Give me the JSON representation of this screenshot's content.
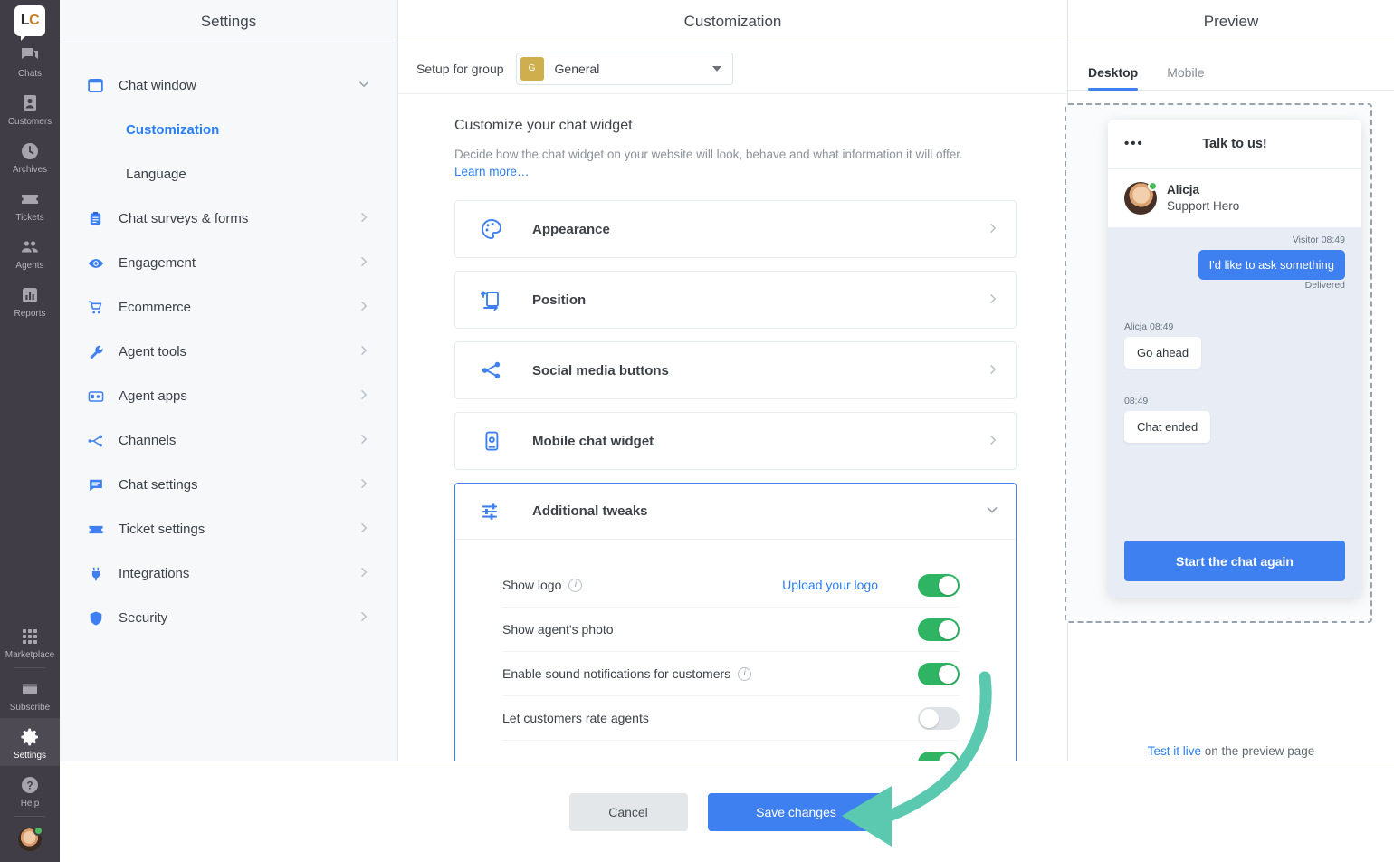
{
  "colors": {
    "accent_blue": "#3f80f0",
    "link_blue": "#2b7ef5",
    "toggle_green": "#2fb463",
    "rail_dark": "#413d46",
    "group_badge_gold": "#cfae4d",
    "annotation_teal": "#5ac9b0"
  },
  "rail": {
    "logo_left": "L",
    "logo_right": "C",
    "items": [
      {
        "label": "Chats",
        "icon": "chats-icon"
      },
      {
        "label": "Customers",
        "icon": "customers-icon"
      },
      {
        "label": "Archives",
        "icon": "archives-icon"
      },
      {
        "label": "Tickets",
        "icon": "tickets-icon"
      },
      {
        "label": "Agents",
        "icon": "agents-icon"
      },
      {
        "label": "Reports",
        "icon": "reports-icon"
      }
    ],
    "bottom_items": [
      {
        "label": "Marketplace",
        "icon": "marketplace-icon",
        "active": false
      },
      {
        "label": "Subscribe",
        "icon": "subscribe-icon",
        "active": false
      },
      {
        "label": "Settings",
        "icon": "gear-icon",
        "active": true
      },
      {
        "label": "Help",
        "icon": "help-icon",
        "active": false
      }
    ]
  },
  "settings": {
    "header": "Settings",
    "items": [
      {
        "label": "Chat window",
        "icon": "window-icon",
        "arrow": "chevron-down-icon"
      },
      {
        "label": "Chat surveys & forms",
        "icon": "clipboard-icon",
        "arrow": "chevron-right-icon"
      },
      {
        "label": "Engagement",
        "icon": "eye-icon",
        "arrow": "chevron-right-icon"
      },
      {
        "label": "Ecommerce",
        "icon": "cart-icon",
        "arrow": "chevron-right-icon"
      },
      {
        "label": "Agent tools",
        "icon": "wrench-icon",
        "arrow": "chevron-right-icon"
      },
      {
        "label": "Agent apps",
        "icon": "apps-icon",
        "arrow": "chevron-right-icon"
      },
      {
        "label": "Channels",
        "icon": "channels-icon",
        "arrow": "chevron-right-icon"
      },
      {
        "label": "Chat settings",
        "icon": "chat-bubble-icon",
        "arrow": "chevron-right-icon"
      },
      {
        "label": "Ticket settings",
        "icon": "ticket-icon",
        "arrow": "chevron-right-icon"
      },
      {
        "label": "Integrations",
        "icon": "plug-icon",
        "arrow": "chevron-right-icon"
      },
      {
        "label": "Security",
        "icon": "shield-icon",
        "arrow": "chevron-right-icon"
      }
    ],
    "sub_items": [
      {
        "label": "Customization",
        "selected": true
      },
      {
        "label": "Language",
        "selected": false
      }
    ]
  },
  "customization": {
    "header": "Customization",
    "group_label": "Setup for group",
    "group_badge": "G",
    "group_value": "General",
    "section_title": "Customize your chat widget",
    "section_desc": "Decide how the chat widget on your website will look, behave and what information it will offer.",
    "learn_more": "Learn more…",
    "cards": [
      {
        "title": "Appearance",
        "icon": "palette-icon"
      },
      {
        "title": "Position",
        "icon": "position-icon"
      },
      {
        "title": "Social media buttons",
        "icon": "share-icon"
      },
      {
        "title": "Mobile chat widget",
        "icon": "mobile-widget-icon"
      }
    ],
    "expanded_card": {
      "title": "Additional tweaks",
      "icon": "sliders-icon"
    },
    "tweaks": [
      {
        "label": "Show logo",
        "has_info": true,
        "link": "Upload your logo",
        "state": "on"
      },
      {
        "label": "Show agent's photo",
        "has_info": false,
        "link": "",
        "state": "on"
      },
      {
        "label": "Enable sound notifications for customers",
        "has_info": true,
        "link": "",
        "state": "on"
      },
      {
        "label": "Let customers rate agents",
        "has_info": false,
        "link": "",
        "state": "off"
      }
    ]
  },
  "preview": {
    "header": "Preview",
    "tabs": [
      {
        "label": "Desktop",
        "active": true
      },
      {
        "label": "Mobile",
        "active": false
      }
    ],
    "widget": {
      "title": "Talk to us!",
      "agent_name": "Alicja",
      "agent_role": "Support Hero",
      "messages": [
        {
          "from": "visitor",
          "meta": "Visitor 08:49",
          "text": "I'd like to ask something",
          "status": "Delivered"
        },
        {
          "from": "agent",
          "meta": "Alicja 08:49",
          "text": "Go ahead",
          "status": ""
        },
        {
          "from": "system",
          "meta": "08:49",
          "text": "Chat ended",
          "status": ""
        }
      ],
      "cta": "Start the chat again"
    },
    "footer_link": "Test it live",
    "footer_rest": " on the preview page"
  },
  "actions": {
    "cancel": "Cancel",
    "save": "Save changes"
  }
}
